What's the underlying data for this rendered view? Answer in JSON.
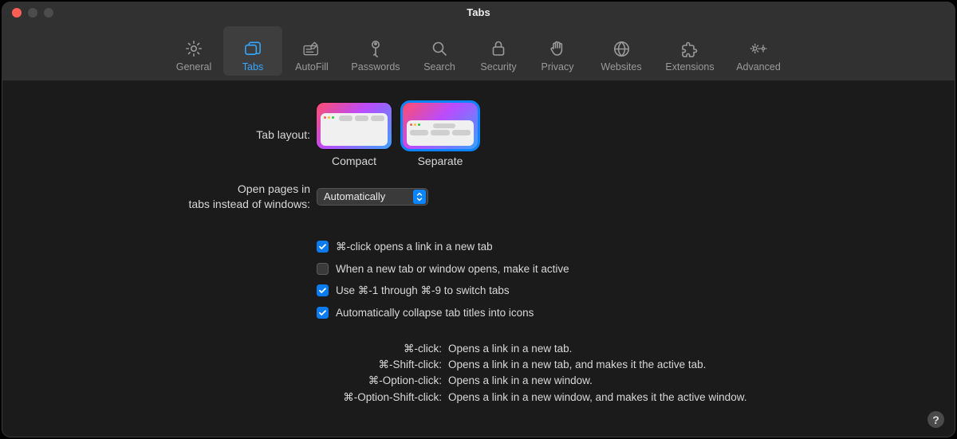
{
  "window": {
    "title": "Tabs"
  },
  "toolbar": {
    "items": [
      {
        "id": "general",
        "label": "General"
      },
      {
        "id": "tabs",
        "label": "Tabs"
      },
      {
        "id": "autofill",
        "label": "AutoFill"
      },
      {
        "id": "passwords",
        "label": "Passwords"
      },
      {
        "id": "search",
        "label": "Search"
      },
      {
        "id": "security",
        "label": "Security"
      },
      {
        "id": "privacy",
        "label": "Privacy"
      },
      {
        "id": "websites",
        "label": "Websites"
      },
      {
        "id": "extensions",
        "label": "Extensions"
      },
      {
        "id": "advanced",
        "label": "Advanced"
      }
    ],
    "selected": "tabs"
  },
  "layout": {
    "label": "Tab layout:",
    "options": [
      {
        "id": "compact",
        "caption": "Compact"
      },
      {
        "id": "separate",
        "caption": "Separate"
      }
    ],
    "selected": "separate"
  },
  "open_in_tabs": {
    "label": "Open pages in\ntabs instead of windows:",
    "value": "Automatically"
  },
  "checkboxes": [
    {
      "id": "cmd_click",
      "checked": true,
      "label": "⌘-click opens a link in a new tab"
    },
    {
      "id": "active_new",
      "checked": false,
      "label": "When a new tab or window opens, make it active"
    },
    {
      "id": "cmd_num",
      "checked": true,
      "label": "Use ⌘-1 through ⌘-9 to switch tabs"
    },
    {
      "id": "collapse",
      "checked": true,
      "label": "Automatically collapse tab titles into icons"
    }
  ],
  "shortcuts": [
    {
      "key": "⌘-click:",
      "desc": "Opens a link in a new tab."
    },
    {
      "key": "⌘-Shift-click:",
      "desc": "Opens a link in a new tab, and makes it the active tab."
    },
    {
      "key": "⌘-Option-click:",
      "desc": "Opens a link in a new window."
    },
    {
      "key": "⌘-Option-Shift-click:",
      "desc": "Opens a link in a new window, and makes it the active window."
    }
  ],
  "help_symbol": "?"
}
